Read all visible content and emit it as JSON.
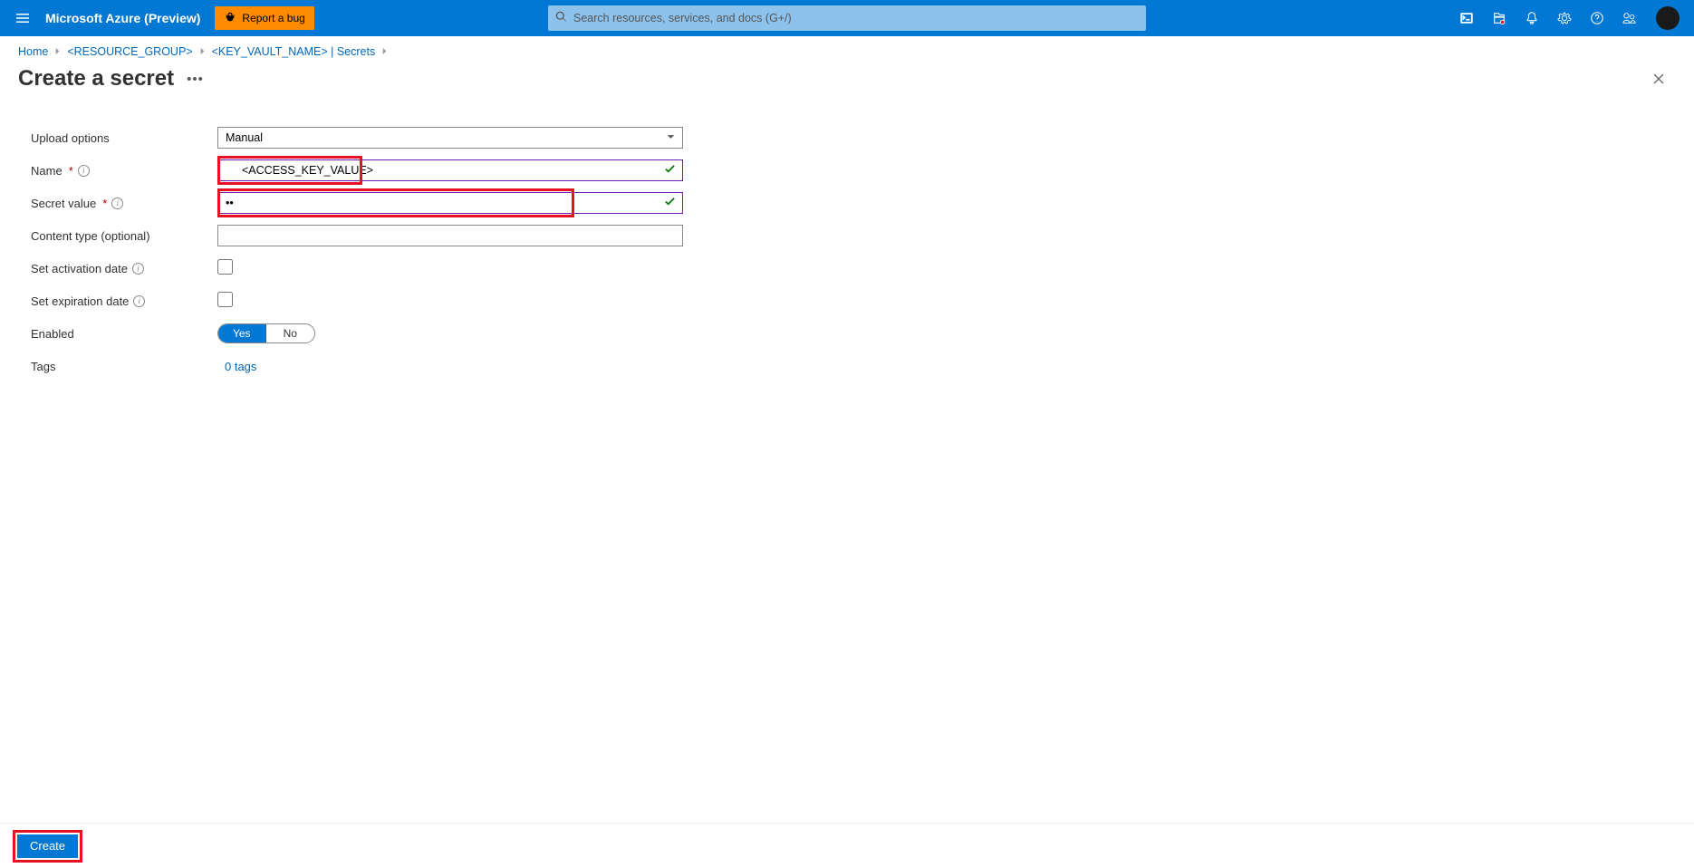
{
  "topbar": {
    "brand": "Microsoft Azure (Preview)",
    "bug_label": "Report a bug",
    "search_placeholder": "Search resources, services, and docs (G+/)"
  },
  "breadcrumbs": {
    "home": "Home",
    "rg": "<RESOURCE_GROUP>",
    "kv": "<KEY_VAULT_NAME>",
    "secrets": "Secrets"
  },
  "title": "Create a secret",
  "form": {
    "upload_label": "Upload options",
    "upload_value": "Manual",
    "name_label": "Name",
    "name_value": "<ACCESS_KEY_VALUE>",
    "secret_label": "Secret value",
    "secret_value": "••",
    "content_label": "Content type (optional)",
    "content_value": "",
    "activate_label": "Set activation date",
    "expire_label": "Set expiration date",
    "enabled_label": "Enabled",
    "toggle_yes": "Yes",
    "toggle_no": "No",
    "tags_label": "Tags",
    "tags_link": "0 tags"
  },
  "footer": {
    "create": "Create"
  }
}
